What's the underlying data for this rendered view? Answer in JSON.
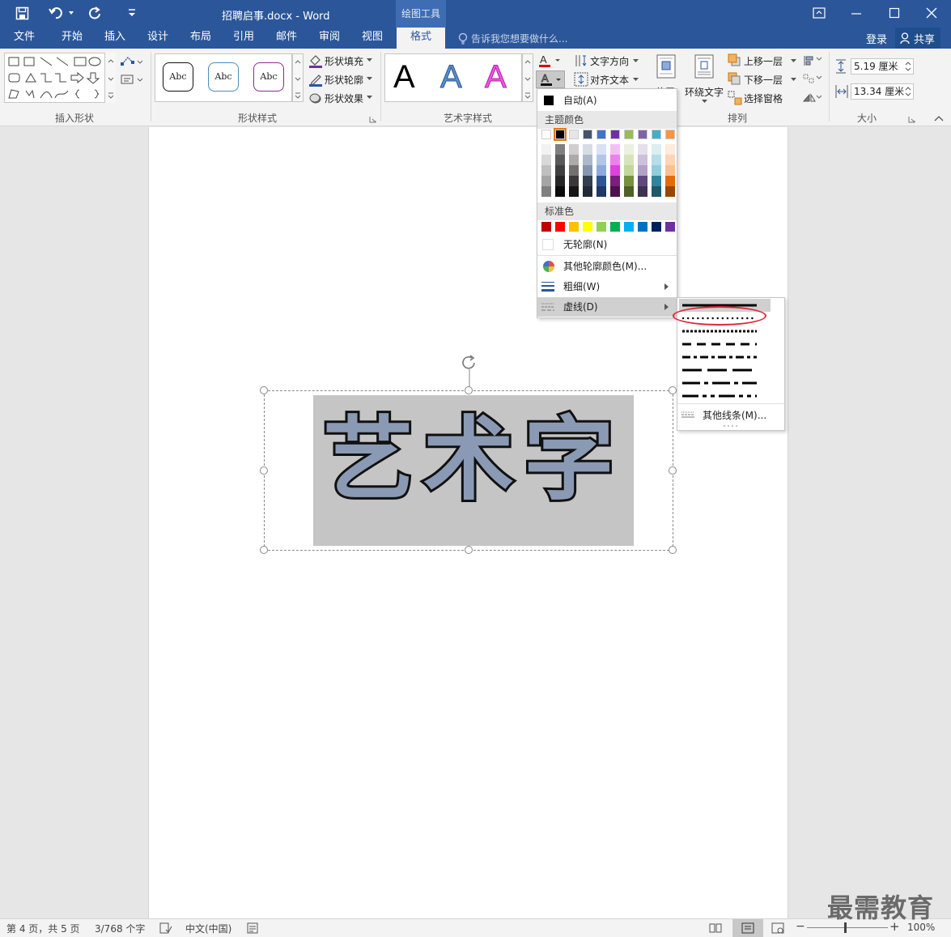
{
  "titlebar": {
    "doc_title": "招聘启事.docx - Word",
    "context_tool": "绘图工具"
  },
  "tabs": [
    {
      "label": "文件"
    },
    {
      "label": "开始"
    },
    {
      "label": "插入"
    },
    {
      "label": "设计"
    },
    {
      "label": "布局"
    },
    {
      "label": "引用"
    },
    {
      "label": "邮件"
    },
    {
      "label": "审阅"
    },
    {
      "label": "视图"
    },
    {
      "label": "格式"
    }
  ],
  "tellme": "告诉我您想要做什么...",
  "account": {
    "login": "登录",
    "share": "共享"
  },
  "ribbon": {
    "groups": {
      "insert_shapes": "插入形状",
      "shape_styles": "形状样式",
      "wordart_styles": "艺术字样式",
      "arrange": "排列",
      "size": "大小"
    },
    "style_sample": "Abc",
    "wordart_sample": "A",
    "shape_fill": "形状填充",
    "shape_outline": "形状轮廓",
    "shape_effects": "形状效果",
    "text_direction": "文字方向",
    "align_text": "对齐文本",
    "position": "位置",
    "wrap_text": "环绕文字",
    "bring_forward": "上移一层",
    "send_backward": "下移一层",
    "selection_pane": "选择窗格",
    "height": "5.19 厘米",
    "width": "13.34 厘米"
  },
  "menu": {
    "auto": "自动(A)",
    "theme_header": "主题颜色",
    "standard_header": "标准色",
    "no_outline": "无轮廓(N)",
    "more_colors": "其他轮廓颜色(M)...",
    "weight": "粗细(W)",
    "dashes": "虚线(D)",
    "theme_top": [
      "#ffffff",
      "#000000",
      "#e7e6e6",
      "#44546a",
      "#4472c4",
      "#7030a0",
      "#9bbb59",
      "#8064a2",
      "#4bacc6",
      "#f79646"
    ],
    "theme_shades": [
      [
        "#f2f2f2",
        "#d8d8d8",
        "#bfbfbf",
        "#a5a5a5",
        "#7f7f7f"
      ],
      [
        "#7f7f7f",
        "#595959",
        "#3f3f3f",
        "#262626",
        "#0c0c0c"
      ],
      [
        "#d0cece",
        "#aeaaaa",
        "#757070",
        "#3a3838",
        "#171616"
      ],
      [
        "#d6dce4",
        "#adb9ca",
        "#8496b0",
        "#323f4f",
        "#222a35"
      ],
      [
        "#d9e2f3",
        "#b4c6e7",
        "#8eaadb",
        "#2f5496",
        "#1f3864"
      ],
      [
        "#f4c0f4",
        "#ec80ec",
        "#e040e0",
        "#7a1f7a",
        "#4d0f4d"
      ],
      [
        "#ebf1de",
        "#d7e3bc",
        "#c3d69b",
        "#76923c",
        "#4f6128"
      ],
      [
        "#e5e0ec",
        "#ccc1d9",
        "#b2a1c7",
        "#5f497a",
        "#3f3151"
      ],
      [
        "#dbeef3",
        "#b7dde8",
        "#92cddc",
        "#31859b",
        "#205867"
      ],
      [
        "#fdeada",
        "#fbd5b5",
        "#fac08f",
        "#e36c09",
        "#974806"
      ]
    ],
    "standard": [
      "#c00000",
      "#ff0000",
      "#ffc000",
      "#ffff00",
      "#92d050",
      "#00b050",
      "#00b0f0",
      "#0070c0",
      "#002060",
      "#7030a0"
    ]
  },
  "submenu": {
    "more_lines": "其他线条(M)..."
  },
  "document": {
    "wordart_text": "艺术字"
  },
  "status": {
    "page": "第 4 页，共 5 页",
    "words": "3/768 个字",
    "language": "中文(中国)",
    "zoom": "100%",
    "zoom_minus": "−",
    "zoom_plus": "+"
  },
  "watermark": "最需教育"
}
